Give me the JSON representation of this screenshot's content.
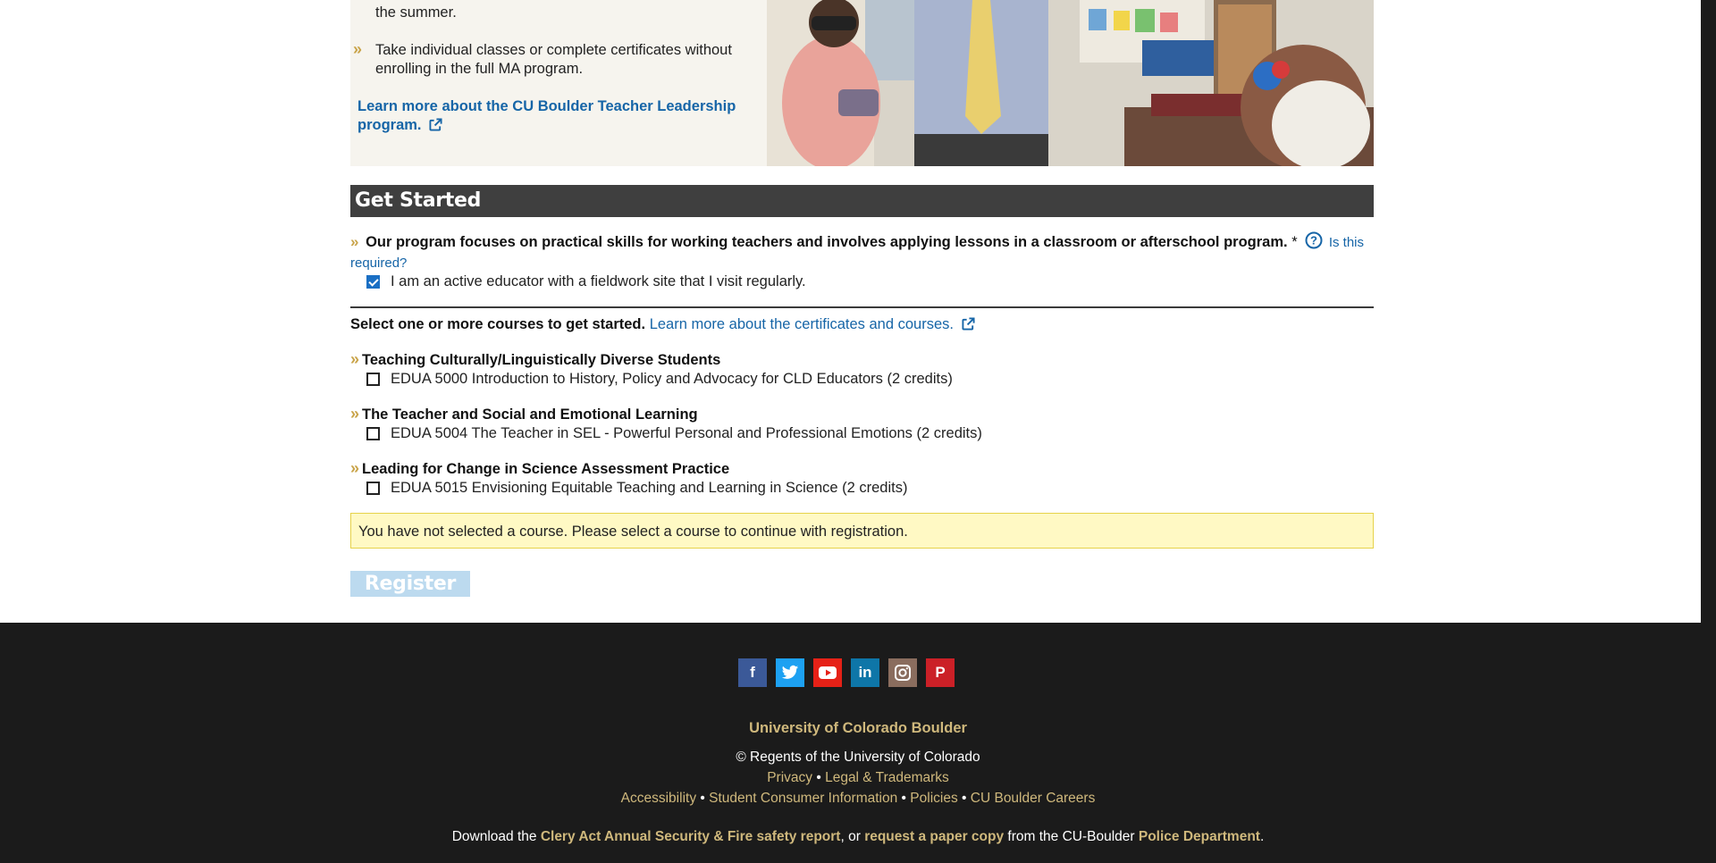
{
  "promo": {
    "bullet1_end": "the summer.",
    "bullet2": "Take individual classes or complete certificates without enrolling in the full MA program.",
    "link": "Learn more about the CU Boulder Teacher Leadership program."
  },
  "get_started": {
    "title": "Get Started",
    "question": "Our program focuses on practical skills for working teachers and involves applying lessons in a classroom or afterschool program.",
    "required_mark": "*",
    "help_link": "Is this required?",
    "confirm_label": "I am an active educator with a fieldwork site that I visit regularly.",
    "confirm_checked": true
  },
  "courses": {
    "intro": "Select one or more courses to get started.",
    "intro_link": "Learn more about the certificates and courses.",
    "groups": [
      {
        "heading": "Teaching Culturally/Linguistically Diverse Students",
        "course": "EDUA 5000 Introduction to History, Policy and Advocacy for CLD Educators (2 credits)",
        "checked": false
      },
      {
        "heading": "The Teacher and Social and Emotional Learning",
        "course": "EDUA 5004 The Teacher in SEL - Powerful Personal and Professional Emotions (2 credits)",
        "checked": false
      },
      {
        "heading": "Leading for Change in Science Assessment Practice",
        "course": "EDUA 5015 Envisioning Equitable Teaching and Learning in Science (2 credits)",
        "checked": false
      }
    ]
  },
  "alert": "You have not selected a course. Please select a course to continue with registration.",
  "register_label": "Register",
  "footer": {
    "social": [
      {
        "icon": "facebook-icon",
        "glyph": "f",
        "color": "#3b5998"
      },
      {
        "icon": "twitter-icon",
        "glyph": "t",
        "color": "#1da1f2"
      },
      {
        "icon": "youtube-icon",
        "glyph": "▶",
        "color": "#e62117"
      },
      {
        "icon": "linkedin-icon",
        "glyph": "in",
        "color": "#0e76a8"
      },
      {
        "icon": "instagram-icon",
        "glyph": "◎",
        "color": "#8a6d5e"
      },
      {
        "icon": "pinterest-icon",
        "glyph": "P",
        "color": "#cb2027"
      }
    ],
    "university": "University of Colorado Boulder",
    "regents": "© Regents of the University of Colorado",
    "privacy": "Privacy",
    "legal": "Legal & Trademarks",
    "accessibility": "Accessibility",
    "consumer_info": "Student Consumer Information",
    "policies": "Policies",
    "careers": "CU Boulder Careers",
    "clery_prefix": "Download the",
    "clery_link": "Clery Act Annual Security & Fire safety report",
    "clery_or": ", or",
    "paper_link": "request a paper copy",
    "clery_from": "from the CU-Boulder",
    "police_link": "Police Department",
    "period": "."
  }
}
